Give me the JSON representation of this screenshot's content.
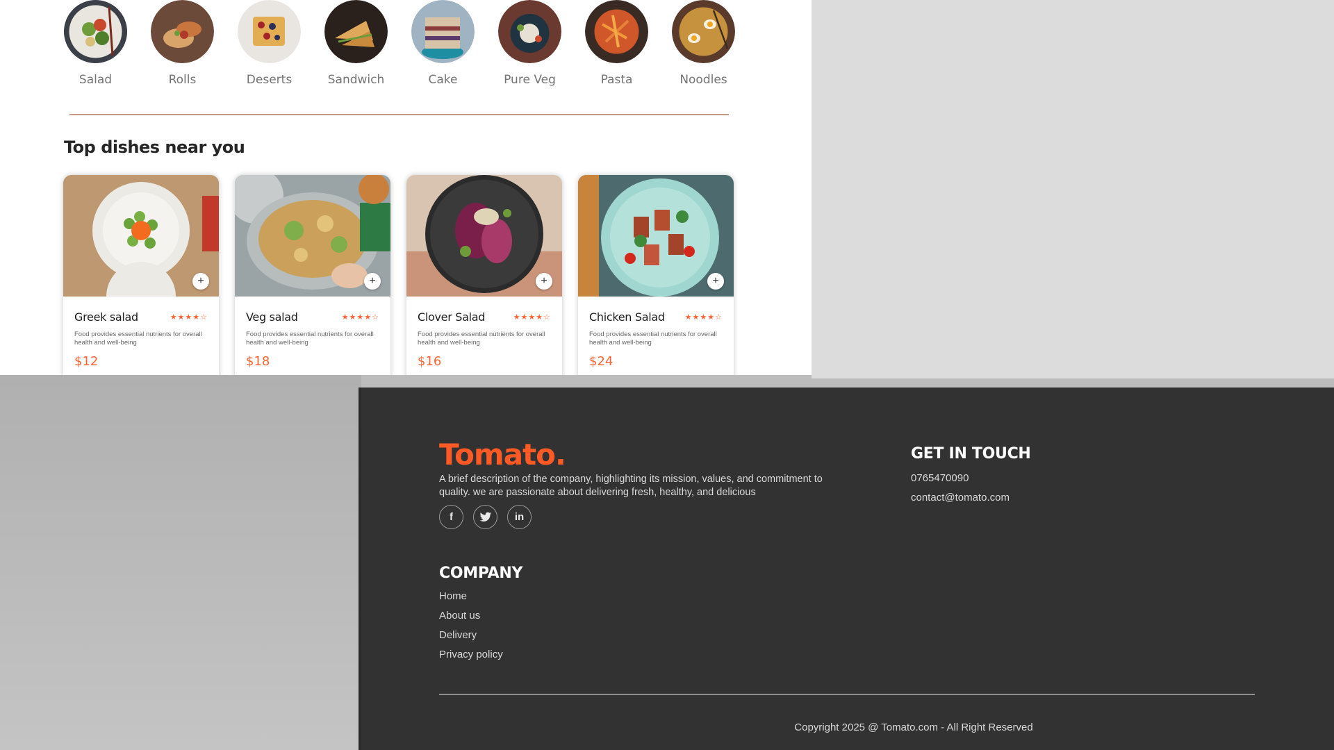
{
  "categories": [
    {
      "label": "Salad",
      "icon": "salad-image"
    },
    {
      "label": "Rolls",
      "icon": "rolls-image"
    },
    {
      "label": "Deserts",
      "icon": "deserts-image"
    },
    {
      "label": "Sandwich",
      "icon": "sandwich-image"
    },
    {
      "label": "Cake",
      "icon": "cake-image"
    },
    {
      "label": "Pure Veg",
      "icon": "pure-veg-image"
    },
    {
      "label": "Pasta",
      "icon": "pasta-image"
    },
    {
      "label": "Noodles",
      "icon": "noodles-image"
    }
  ],
  "section_title": "Top dishes near you",
  "dishes": [
    {
      "name": "Greek salad",
      "rating": "★★★★☆",
      "description": "Food provides essential nutrients for overall health and well-being",
      "price": "$12",
      "add": "+"
    },
    {
      "name": "Veg salad",
      "rating": "★★★★☆",
      "description": "Food provides essential nutrients for overall health and well-being",
      "price": "$18",
      "add": "+"
    },
    {
      "name": "Clover Salad",
      "rating": "★★★★☆",
      "description": "Food provides essential nutrients for overall health and well-being",
      "price": "$16",
      "add": "+"
    },
    {
      "name": "Chicken Salad",
      "rating": "★★★★☆",
      "description": "Food provides essential nutrients for overall health and well-being",
      "price": "$24",
      "add": "+"
    }
  ],
  "footer": {
    "logo": "Tomato.",
    "about": "A brief description of the company, highlighting its mission, values, and commitment to quality. we are passionate about delivering fresh, healthy, and delicious",
    "socials": [
      {
        "label": "f",
        "icon": "facebook-icon"
      },
      {
        "label": "🐦",
        "icon": "twitter-icon"
      },
      {
        "label": "in",
        "icon": "linkedin-icon"
      }
    ],
    "get_in_touch_title": "GET IN TOUCH",
    "phone": "0765470090",
    "email": "contact@tomato.com",
    "company_title": "COMPANY",
    "company_links": [
      "Home",
      "About us",
      "Delivery",
      "Privacy policy"
    ],
    "copyright": "Copyright 2025 @ Tomato.com - All Right Reserved"
  },
  "colors": {
    "accent": "#ff6534",
    "footer_bg": "#323232",
    "logo": "#ff5a26"
  }
}
